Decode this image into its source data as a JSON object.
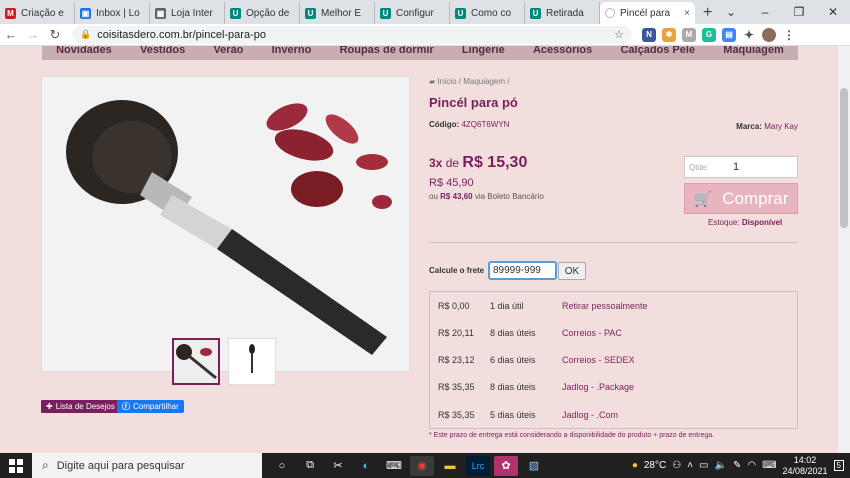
{
  "browser": {
    "tabs": [
      {
        "title": "Criação e",
        "color": "#c5221f",
        "glyph": "M"
      },
      {
        "title": "Inbox | Lo",
        "color": "#1a73e8",
        "glyph": "▣"
      },
      {
        "title": "Loja Inter",
        "color": "#5f6368",
        "glyph": "▦"
      },
      {
        "title": "Opção de",
        "color": "#00897b",
        "glyph": "U"
      },
      {
        "title": "Melhor E",
        "color": "#00897b",
        "glyph": "U"
      },
      {
        "title": "Configur",
        "color": "#00897b",
        "glyph": "U"
      },
      {
        "title": "Como co",
        "color": "#00897b",
        "glyph": "U"
      },
      {
        "title": "Retirada",
        "color": "#00897b",
        "glyph": "U"
      }
    ],
    "active_tab": {
      "title": "Pincél para",
      "close": "×"
    },
    "new_tab": "+",
    "url": "coisitasdero.com.br/pincel-para-po"
  },
  "menu": [
    "Novidades",
    "Vestidos",
    "Verão",
    "Inverno",
    "Roupas de dormir",
    "Lingerie",
    "Acessórios",
    "Calçados Pele",
    "Maquiagem"
  ],
  "breadcrumb": {
    "home": "Início",
    "sep": "/",
    "category": "Maquiagem"
  },
  "product": {
    "title": "Pincél para pó",
    "code_label": "Código:",
    "code": "4ZQ6T6WYN",
    "brand_label": "Marca:",
    "brand": "Mary Kay",
    "installments": "3x",
    "installments_de": "de",
    "installment_value": "R$ 15,30",
    "price": "R$ 45,90",
    "boleto_prefix": "ou",
    "boleto_price": "R$ 43,60",
    "boleto_suffix": "via Boleto Bancário",
    "qty_label": "Qtde:",
    "qty_value": "1",
    "buy_label": "Comprar",
    "stock_label": "Estoque:",
    "stock_value": "Disponível"
  },
  "actions": {
    "wishlist": "Lista de Desejos",
    "share": "Compartilhar"
  },
  "shipping": {
    "label": "Calcule o frete",
    "cep": "89999-999",
    "ok": "OK",
    "options": [
      {
        "price": "R$ 0,00",
        "days": "1 dia útil",
        "name": "Retirar pessoalmente"
      },
      {
        "price": "R$ 20,11",
        "days": "8 dias úteis",
        "name": "Correios - PAC"
      },
      {
        "price": "R$ 23,12",
        "days": "6 dias úteis",
        "name": "Correios - SEDEX"
      },
      {
        "price": "R$ 35,35",
        "days": "8 dias úteis",
        "name": "Jadlog - .Package"
      },
      {
        "price": "R$ 35,35",
        "days": "5 dias úteis",
        "name": "Jadlog - .Com"
      }
    ],
    "note": "* Este prazo de entrega está considerando a disponibilidade do produto + prazo de entrega."
  },
  "taskbar": {
    "search_placeholder": "Digite aqui para pesquisar",
    "weather": "28°C",
    "time": "14:02",
    "date": "24/08/2021",
    "notifications": "5"
  }
}
